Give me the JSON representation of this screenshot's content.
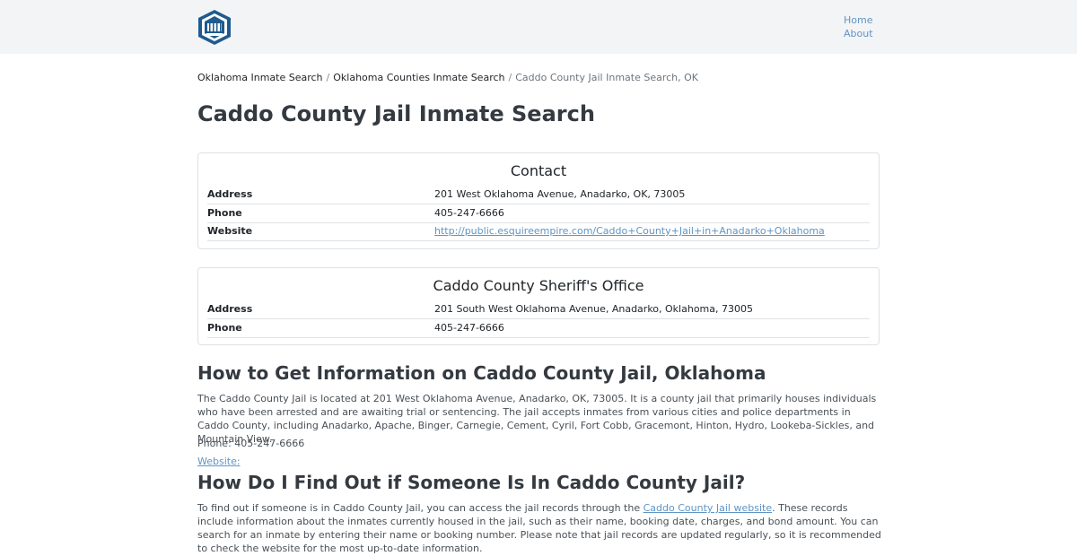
{
  "header": {
    "logo_icon": "jail-badge-icon",
    "nav": [
      {
        "label": "Home"
      },
      {
        "label": "About"
      }
    ]
  },
  "breadcrumb": {
    "items": [
      "Oklahoma Inmate Search",
      "Oklahoma Counties Inmate Search"
    ],
    "separator": "/",
    "current": "Caddo County Jail Inmate Search, OK"
  },
  "page_title": "Caddo County Jail Inmate Search",
  "contact_card": {
    "title": "Contact",
    "rows": [
      {
        "label": "Address",
        "value": "201 West Oklahoma Avenue, Anadarko, OK, 73005"
      },
      {
        "label": "Phone",
        "value": "405-247-6666"
      },
      {
        "label": "Website",
        "value": "http://public.esquireempire.com/Caddo+County+Jail+in+Anadarko+Oklahoma"
      }
    ]
  },
  "sheriff_card": {
    "title": "Caddo County Sheriff's Office",
    "rows": [
      {
        "label": "Address",
        "value": "201 South West Oklahoma Avenue, Anadarko, Oklahoma, 73005"
      },
      {
        "label": "Phone",
        "value": "405-247-6666"
      }
    ]
  },
  "section1": {
    "heading": "How to Get Information on Caddo County Jail, Oklahoma",
    "paragraph": "The Caddo County Jail is located at 201 West Oklahoma Avenue, Anadarko, OK, 73005. It is a county jail that primarily houses individuals who have been arrested and are awaiting trial or sentencing. The jail accepts inmates from various cities and police departments in Caddo County, including Anadarko, Apache, Binger, Carnegie, Cement, Cyril, Fort Cobb, Gracemont, Hinton, Hydro, Lookeba-Sickles, and Mountain View.",
    "phone_line": "Phone: 405-247-6666",
    "website_link": "Website:"
  },
  "section2": {
    "heading": "How Do I Find Out if Someone Is In Caddo County Jail?",
    "para_before": "To find out if someone is in Caddo County Jail, you can access the jail records through the ",
    "link_text": "Caddo County Jail website",
    "para_after": ". These records include information about the inmates currently housed in the jail, such as their name, booking date, charges, and bond amount. You can search for an inmate by entering their name or booking number. Please note that jail records are updated regularly, so it is recommended to check the website for the most up-to-date information."
  },
  "colors": {
    "link": "#5f95c5",
    "header_bg": "#f3f4f6",
    "heading": "#343a40",
    "logo_blue": "#1f5b8f"
  }
}
